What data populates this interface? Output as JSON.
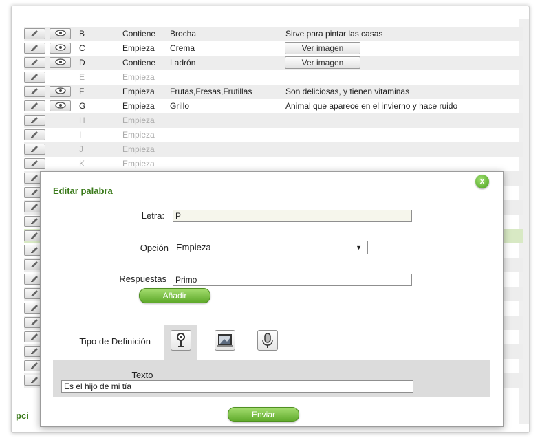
{
  "table": {
    "edit_icon": "pencil-hand-icon",
    "view_icon": "eye-icon",
    "view_image_label": "Ver imagen",
    "rows": [
      {
        "letter": "B",
        "option": "Contiene",
        "word": "Brocha",
        "definition": "Sirve para pintar las casas",
        "has_eye": true,
        "image": false,
        "empty": false
      },
      {
        "letter": "C",
        "option": "Empieza",
        "word": "Crema",
        "definition": "",
        "has_eye": true,
        "image": true,
        "empty": false
      },
      {
        "letter": "D",
        "option": "Contiene",
        "word": "Ladrón",
        "definition": "",
        "has_eye": true,
        "image": true,
        "empty": false
      },
      {
        "letter": "E",
        "option": "Empieza",
        "word": "",
        "definition": "",
        "has_eye": false,
        "image": false,
        "empty": true
      },
      {
        "letter": "F",
        "option": "Empieza",
        "word": "Frutas,Fresas,Frutillas",
        "definition": "Son deliciosas, y tienen vitaminas",
        "has_eye": true,
        "image": false,
        "empty": false
      },
      {
        "letter": "G",
        "option": "Empieza",
        "word": "Grillo",
        "definition": "Animal que aparece en el invierno y hace ruido",
        "has_eye": true,
        "image": false,
        "empty": false
      },
      {
        "letter": "H",
        "option": "Empieza",
        "word": "",
        "definition": "",
        "has_eye": false,
        "image": false,
        "empty": true
      },
      {
        "letter": "I",
        "option": "Empieza",
        "word": "",
        "definition": "",
        "has_eye": false,
        "image": false,
        "empty": true
      },
      {
        "letter": "J",
        "option": "Empieza",
        "word": "",
        "definition": "",
        "has_eye": false,
        "image": false,
        "empty": true
      },
      {
        "letter": "K",
        "option": "Empieza",
        "word": "",
        "definition": "",
        "has_eye": false,
        "image": false,
        "empty": true
      }
    ]
  },
  "modal": {
    "title": "Editar palabra",
    "close_label": "x",
    "letter_label": "Letra:",
    "letter_value": "P",
    "option_label": "Opción",
    "option_value": "Empieza",
    "answers_label": "Respuestas",
    "answers_value": "Primo",
    "add_button": "Añadir",
    "definition_type_label": "Tipo de Definición",
    "definition_types": [
      "text-definition-icon",
      "image-definition-icon",
      "audio-definition-icon"
    ],
    "text_label": "Texto",
    "text_value": "Es el hijo de mi tía",
    "submit_button": "Enviar"
  },
  "footer": {
    "partial_heading": "pci"
  },
  "colors": {
    "accent_green": "#5ea92a",
    "title_green": "#3a7a1a",
    "highlight_row": "#d8e9c4"
  }
}
